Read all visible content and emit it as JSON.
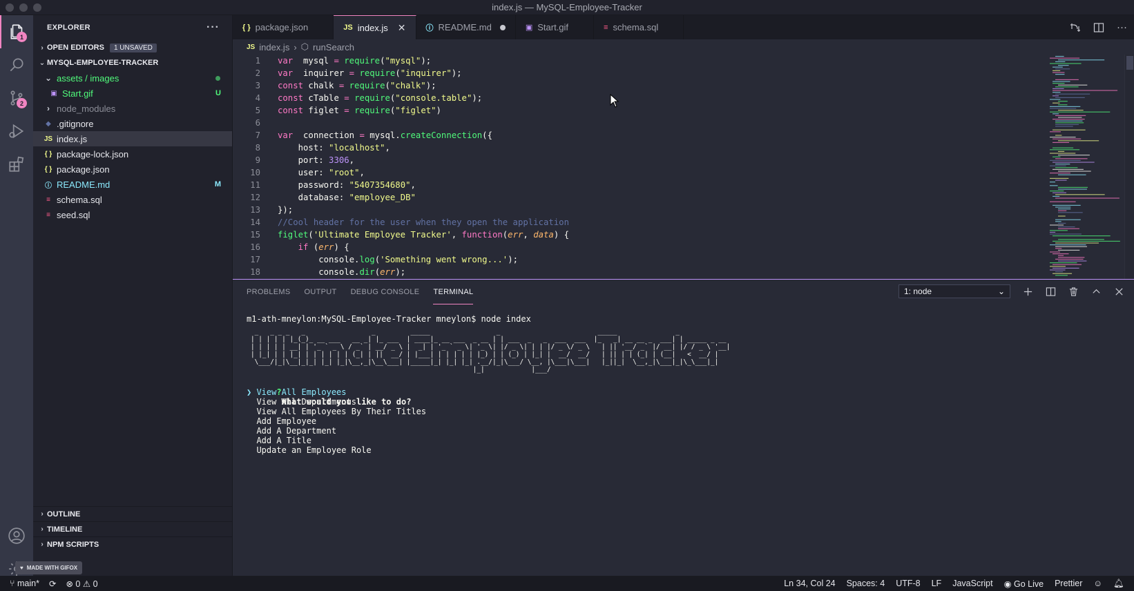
{
  "window": {
    "title": "index.js — MySQL-Employee-Tracker"
  },
  "activity": {
    "explorer_badge": "1",
    "scm_badge": "2",
    "items": [
      "files-icon",
      "search-icon",
      "source-control-icon",
      "run-debug-icon",
      "extensions-icon",
      "account-icon",
      "gear-icon"
    ]
  },
  "sidebar": {
    "header": "EXPLORER",
    "open_editors": {
      "label": "OPEN EDITORS",
      "badge": "1 UNSAVED"
    },
    "project": "MYSQL-EMPLOYEE-TRACKER",
    "tree": [
      {
        "name": "assets / images",
        "type": "folder-open",
        "indent": 1,
        "color": "#50fa7b",
        "status": "dot"
      },
      {
        "name": "Start.gif",
        "type": "gif",
        "indent": 2,
        "color": "#50fa7b",
        "status": "U"
      },
      {
        "name": "node_modules",
        "type": "folder",
        "indent": 1,
        "color": "#8c8e98",
        "status": ""
      },
      {
        "name": ".gitignore",
        "type": "git",
        "indent": 1,
        "color": "#e6e7ec",
        "status": ""
      },
      {
        "name": "index.js",
        "type": "js",
        "indent": 1,
        "color": "#e6e7ec",
        "status": "",
        "selected": true
      },
      {
        "name": "package-lock.json",
        "type": "json",
        "indent": 1,
        "color": "#e6e7ec",
        "status": ""
      },
      {
        "name": "package.json",
        "type": "json",
        "indent": 1,
        "color": "#e6e7ec",
        "status": ""
      },
      {
        "name": "README.md",
        "type": "info",
        "indent": 1,
        "color": "#8be9fd",
        "status": "M"
      },
      {
        "name": "schema.sql",
        "type": "sql",
        "indent": 1,
        "color": "#e6e7ec",
        "status": ""
      },
      {
        "name": "seed.sql",
        "type": "sql",
        "indent": 1,
        "color": "#e6e7ec",
        "status": ""
      }
    ],
    "outline": "OUTLINE",
    "timeline": "TIMELINE",
    "npm_scripts": "NPM SCRIPTS"
  },
  "tabs": [
    {
      "label": "package.json",
      "icon": "{ }",
      "active": false,
      "dirty": false
    },
    {
      "label": "index.js",
      "icon": "JS",
      "active": true,
      "dirty": false
    },
    {
      "label": "README.md",
      "icon": "ⓘ",
      "active": false,
      "dirty": true
    },
    {
      "label": "Start.gif",
      "icon": "▣",
      "active": false,
      "dirty": false
    },
    {
      "label": "schema.sql",
      "icon": "≡",
      "active": false,
      "dirty": false
    }
  ],
  "breadcrumb": {
    "file": "index.js",
    "symbol": "runSearch"
  },
  "code": [
    [
      [
        "kw",
        "var "
      ],
      [
        "t",
        " mysql "
      ],
      [
        "op",
        "= "
      ],
      [
        "fn",
        "require"
      ],
      [
        "t",
        "("
      ],
      [
        "str",
        "\"mysql\""
      ],
      [
        "t",
        ");"
      ]
    ],
    [
      [
        "kw",
        "var "
      ],
      [
        "t",
        " inquirer "
      ],
      [
        "op",
        "= "
      ],
      [
        "fn",
        "require"
      ],
      [
        "t",
        "("
      ],
      [
        "str",
        "\"inquirer\""
      ],
      [
        "t",
        ");"
      ]
    ],
    [
      [
        "kw",
        "const "
      ],
      [
        "t",
        "chalk "
      ],
      [
        "op",
        "= "
      ],
      [
        "fn",
        "require"
      ],
      [
        "t",
        "("
      ],
      [
        "str",
        "\"chalk\""
      ],
      [
        "t",
        ");"
      ]
    ],
    [
      [
        "kw",
        "const "
      ],
      [
        "t",
        "cTable "
      ],
      [
        "op",
        "= "
      ],
      [
        "fn",
        "require"
      ],
      [
        "t",
        "("
      ],
      [
        "str",
        "\"console.table\""
      ],
      [
        "t",
        ");"
      ]
    ],
    [
      [
        "kw",
        "const "
      ],
      [
        "t",
        "figlet "
      ],
      [
        "op",
        "= "
      ],
      [
        "fn",
        "require"
      ],
      [
        "t",
        "("
      ],
      [
        "str",
        "\"figlet\""
      ],
      [
        "t",
        ")"
      ]
    ],
    [],
    [
      [
        "kw",
        "var "
      ],
      [
        "t",
        " connection "
      ],
      [
        "op",
        "= "
      ],
      [
        "t",
        "mysql."
      ],
      [
        "fn",
        "createConnection"
      ],
      [
        "t",
        "({"
      ]
    ],
    [
      [
        "t",
        "    host: "
      ],
      [
        "str",
        "\"localhost\""
      ],
      [
        "t",
        ","
      ]
    ],
    [
      [
        "t",
        "    port: "
      ],
      [
        "num",
        "3306"
      ],
      [
        "t",
        ","
      ]
    ],
    [
      [
        "t",
        "    user: "
      ],
      [
        "str",
        "\"root\""
      ],
      [
        "t",
        ","
      ]
    ],
    [
      [
        "t",
        "    password: "
      ],
      [
        "str",
        "\"5407354680\""
      ],
      [
        "t",
        ","
      ]
    ],
    [
      [
        "t",
        "    database: "
      ],
      [
        "str",
        "\"employee_DB\""
      ]
    ],
    [
      [
        "t",
        "});"
      ]
    ],
    [
      [
        "cm",
        "//Cool header for the user when they open the application"
      ]
    ],
    [
      [
        "fn",
        "figlet"
      ],
      [
        "t",
        "("
      ],
      [
        "str",
        "'Ultimate Employee Tracker'"
      ],
      [
        "t",
        ", "
      ],
      [
        "kw",
        "function"
      ],
      [
        "t",
        "("
      ],
      [
        "it",
        "err"
      ],
      [
        "t",
        ", "
      ],
      [
        "it",
        "data"
      ],
      [
        "t",
        ") {"
      ]
    ],
    [
      [
        "kw",
        "    if "
      ],
      [
        "t",
        "("
      ],
      [
        "it",
        "err"
      ],
      [
        "t",
        ") {"
      ]
    ],
    [
      [
        "t",
        "        console."
      ],
      [
        "fn",
        "log"
      ],
      [
        "t",
        "("
      ],
      [
        "str",
        "'Something went wrong...'"
      ],
      [
        "t",
        ");"
      ]
    ],
    [
      [
        "t",
        "        console."
      ],
      [
        "fn",
        "dir"
      ],
      [
        "t",
        "("
      ],
      [
        "it",
        "err"
      ],
      [
        "t",
        ");"
      ]
    ]
  ],
  "panel": {
    "tabs": [
      "PROBLEMS",
      "OUTPUT",
      "DEBUG CONSOLE",
      "TERMINAL"
    ],
    "active_tab": "TERMINAL",
    "terminal_select": "1: node"
  },
  "terminal": {
    "prompt": "m1-ath-mneylon:MySQL-Employee-Tracker mneylon$ node index",
    "ascii_art": [
      " _   _ _ _   _                 _         _____                 _                         _____               _             ",
      "| | | | | |_(_)_ __ ___   __ _| |_ ___  | ____|_ __ ___  _ __ | | ___  _   _  ___  ___  |_   _| __ __ _  ___| | _____ _ __ ",
      "| | | | | __| | '_ ` _ \\ / _` | __/ _ \\ |  _| | '_ ` _ \\| '_ \\| |/ _ \\| | | |/ _ \\/ _ \\   | || '__/ _` |/ __| |/ / _ \\ '__|",
      "| |_| | | |_| | | | | | | (_| | ||  __/ | |___| | | | | | |_) | | (_) | |_| |  __/  __/   | || | | (_| | (__|   <  __/ |   ",
      " \\___/|_|\\__|_|_| |_| |_|\\__,_|\\__\\___| |_____|_| |_| |_| .__/|_|\\___/ \\__, |\\___|\\___|   |_||_|  \\__,_|\\___|_|\\_\\___|_|   ",
      "                                                         |_|            |___/                                                "
    ],
    "question_mark": "?",
    "question": "What would you like to do?",
    "pointer": "❯",
    "options": [
      "View All Employees",
      "View All Departments",
      "View All Employees By Their Titles",
      "Add Employee",
      "Add A Department",
      "Add A Title",
      "Update an Employee Role"
    ],
    "selected_option": 0
  },
  "statusbar": {
    "branch": "main*",
    "errors": "0",
    "warnings": "0",
    "position": "Ln 34, Col 24",
    "spaces": "Spaces: 4",
    "encoding": "UTF-8",
    "eol": "LF",
    "language": "JavaScript",
    "golive": "Go Live",
    "prettier": "Prettier"
  },
  "watermark": "MADE WITH GIFOX",
  "colors": {
    "kw": "#ff79c6",
    "fn": "#50fa7b",
    "str": "#f1fa8c",
    "num": "#bd93f9",
    "cm": "#6272a4",
    "it": "#ffb86c",
    "t": "#f8f8f2",
    "op": "#ff79c6",
    "accent": "#f185c2",
    "selection_green": "#8be9fd"
  }
}
